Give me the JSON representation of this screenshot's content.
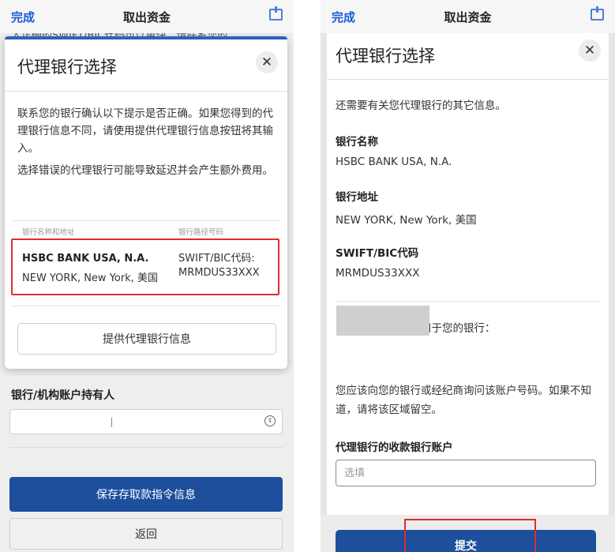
{
  "nav": {
    "done_label": "完成",
    "title": "取出资金"
  },
  "left_background": {
    "obscured_text": "入正确的SWIFT/BIC代码可以更快。请联系您的",
    "holder_label": "银行/机构账户持有人",
    "save_button": "保存存取款指令信息",
    "back_button": "返回"
  },
  "modal": {
    "title": "代理银行选择",
    "close_symbol": "✕",
    "paragraph_1": "联系您的银行确认以下提示是否正确。如果您得到的代理银行信息不同，请使用提供代理银行信息按钮将其输入。",
    "paragraph_2": "选择错误的代理银行可能导致延迟并会产生额外费用。",
    "column_headers": [
      "银行名称和地址",
      "银行路径号码"
    ],
    "bank": {
      "name": "HSBC BANK USA, N.A.",
      "address": "NEW YORK, New York, 美国",
      "swift_label": "SWIFT/BIC代码:",
      "swift_code": "MRMDUS33XXX"
    },
    "provide_button": "提供代理银行信息"
  },
  "right_panel": {
    "title": "代理银行选择",
    "close_symbol": "✕",
    "intro": "还需要有关您代理银行的其它信息。",
    "bank_name_label": "银行名称",
    "bank_name": "HSBC BANK USA, N.A.",
    "bank_address_label": "银行地址",
    "bank_address": "NEW YORK, New York, 美国",
    "swift_label": "SWIFT/BIC代码",
    "swift_code": "MRMDUS33XXX",
    "account_note": "以下账户号码通常用于您的银行：",
    "advice": "您应该向您的银行或经纪商询问该账户号码。如果不知道，请将该区域留空。",
    "account_field_label": "代理银行的收款银行账户",
    "account_field_placeholder": "选填",
    "submit_button": "提交"
  },
  "colors": {
    "accent_blue": "#1e4f9c",
    "link_blue": "#1d5bd6",
    "highlight_red": "#d9302c"
  }
}
